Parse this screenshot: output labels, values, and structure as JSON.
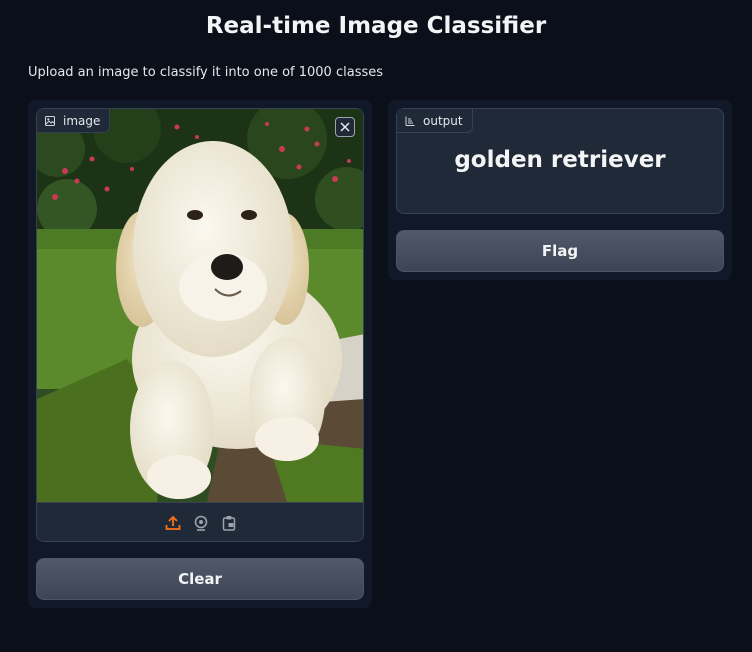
{
  "header": {
    "title": "Real-time Image Classifier",
    "description": "Upload an image to classify it into one of 1000 classes"
  },
  "input_panel": {
    "label": "image",
    "label_icon": "image-icon",
    "clear_icon": "close-icon",
    "photo_subject": "puppy-photo",
    "sources": [
      "upload-icon",
      "webcam-icon",
      "clipboard-icon"
    ],
    "active_source": "upload-icon",
    "active_color": "#f97316",
    "clear_label": "Clear"
  },
  "output_panel": {
    "label": "output",
    "label_icon": "label-icon",
    "value": "golden retriever",
    "flag_label": "Flag"
  },
  "colors": {
    "background": "#0b0f19",
    "panel": "#111827",
    "block": "#1f2937",
    "border": "#374151"
  }
}
